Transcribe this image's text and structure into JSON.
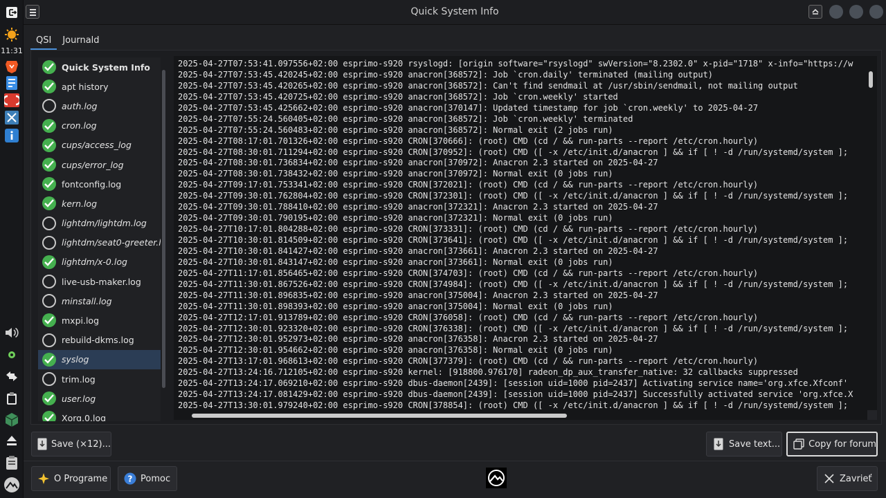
{
  "panel": {
    "clock": "11:31",
    "icons": [
      "exit-icon",
      "weather-icon",
      "brave-browser-icon",
      "text-editor-icon",
      "app-icon",
      "tools-icon",
      "info-icon",
      "volume-icon",
      "settings-icon",
      "network-icon",
      "clipboard-icon",
      "package-icon",
      "eject-icon",
      "clipboard-manager-icon",
      "mx-logo-icon"
    ]
  },
  "window": {
    "title": "Quick System Info",
    "buttons": [
      "menu-icon",
      "maximize-icon",
      "minimize-icon",
      "close-icon"
    ]
  },
  "tabs": [
    {
      "label": "QSI",
      "active": true
    },
    {
      "label": "Journald",
      "active": false
    }
  ],
  "files": [
    {
      "label": "Quick System Info",
      "checked": true,
      "bold": true,
      "italic": false
    },
    {
      "label": "apt history",
      "checked": true,
      "bold": false,
      "italic": false
    },
    {
      "label": "auth.log",
      "checked": false,
      "bold": false,
      "italic": true
    },
    {
      "label": "cron.log",
      "checked": true,
      "bold": false,
      "italic": true
    },
    {
      "label": "cups/access_log",
      "checked": true,
      "bold": false,
      "italic": true
    },
    {
      "label": "cups/error_log",
      "checked": true,
      "bold": false,
      "italic": true
    },
    {
      "label": "fontconfig.log",
      "checked": true,
      "bold": false,
      "italic": false
    },
    {
      "label": "kern.log",
      "checked": true,
      "bold": false,
      "italic": true
    },
    {
      "label": "lightdm/lightdm.log",
      "checked": false,
      "bold": false,
      "italic": true
    },
    {
      "label": "lightdm/seat0-greeter.log",
      "checked": false,
      "bold": false,
      "italic": true
    },
    {
      "label": "lightdm/x-0.log",
      "checked": true,
      "bold": false,
      "italic": true
    },
    {
      "label": "live-usb-maker.log",
      "checked": false,
      "bold": false,
      "italic": false
    },
    {
      "label": "minstall.log",
      "checked": false,
      "bold": false,
      "italic": true
    },
    {
      "label": "mxpi.log",
      "checked": true,
      "bold": false,
      "italic": false
    },
    {
      "label": "rebuild-dkms.log",
      "checked": false,
      "bold": false,
      "italic": false
    },
    {
      "label": "syslog",
      "checked": true,
      "bold": false,
      "italic": true,
      "selected": true
    },
    {
      "label": "trim.log",
      "checked": false,
      "bold": false,
      "italic": false
    },
    {
      "label": "user.log",
      "checked": true,
      "bold": false,
      "italic": true
    },
    {
      "label": "Xorg.0.log",
      "checked": true,
      "bold": false,
      "italic": false
    }
  ],
  "log_lines": [
    "2025-04-27T07:53:41.097556+02:00 esprimo-s920 rsyslogd: [origin software=\"rsyslogd\" swVersion=\"8.2302.0\" x-pid=\"1718\" x-info=\"https://w",
    "2025-04-27T07:53:45.420245+02:00 esprimo-s920 anacron[368572]: Job `cron.daily' terminated (mailing output)",
    "2025-04-27T07:53:45.420265+02:00 esprimo-s920 anacron[368572]: Can't find sendmail at /usr/sbin/sendmail, not mailing output",
    "2025-04-27T07:53:45.420725+02:00 esprimo-s920 anacron[368572]: Job `cron.weekly' started",
    "2025-04-27T07:53:45.425662+02:00 esprimo-s920 anacron[370147]: Updated timestamp for job `cron.weekly' to 2025-04-27",
    "2025-04-27T07:55:24.560405+02:00 esprimo-s920 anacron[368572]: Job `cron.weekly' terminated",
    "2025-04-27T07:55:24.560483+02:00 esprimo-s920 anacron[368572]: Normal exit (2 jobs run)",
    "2025-04-27T08:17:01.701326+02:00 esprimo-s920 CRON[370666]: (root) CMD (cd / && run-parts --report /etc/cron.hourly)",
    "2025-04-27T08:30:01.711294+02:00 esprimo-s920 CRON[370952]: (root) CMD ([ -x /etc/init.d/anacron ] && if [ ! -d /run/systemd/system ];",
    "2025-04-27T08:30:01.736834+02:00 esprimo-s920 anacron[370972]: Anacron 2.3 started on 2025-04-27",
    "2025-04-27T08:30:01.738432+02:00 esprimo-s920 anacron[370972]: Normal exit (0 jobs run)",
    "2025-04-27T09:17:01.753341+02:00 esprimo-s920 CRON[372021]: (root) CMD (cd / && run-parts --report /etc/cron.hourly)",
    "2025-04-27T09:30:01.762804+02:00 esprimo-s920 CRON[372301]: (root) CMD ([ -x /etc/init.d/anacron ] && if [ ! -d /run/systemd/system ];",
    "2025-04-27T09:30:01.788410+02:00 esprimo-s920 anacron[372321]: Anacron 2.3 started on 2025-04-27",
    "2025-04-27T09:30:01.790195+02:00 esprimo-s920 anacron[372321]: Normal exit (0 jobs run)",
    "2025-04-27T10:17:01.804288+02:00 esprimo-s920 CRON[373331]: (root) CMD (cd / && run-parts --report /etc/cron.hourly)",
    "2025-04-27T10:30:01.814509+02:00 esprimo-s920 CRON[373641]: (root) CMD ([ -x /etc/init.d/anacron ] && if [ ! -d /run/systemd/system ];",
    "2025-04-27T10:30:01.841427+02:00 esprimo-s920 anacron[373661]: Anacron 2.3 started on 2025-04-27",
    "2025-04-27T10:30:01.843147+02:00 esprimo-s920 anacron[373661]: Normal exit (0 jobs run)",
    "2025-04-27T11:17:01.856465+02:00 esprimo-s920 CRON[374703]: (root) CMD (cd / && run-parts --report /etc/cron.hourly)",
    "2025-04-27T11:30:01.867526+02:00 esprimo-s920 CRON[374984]: (root) CMD ([ -x /etc/init.d/anacron ] && if [ ! -d /run/systemd/system ];",
    "2025-04-27T11:30:01.896835+02:00 esprimo-s920 anacron[375004]: Anacron 2.3 started on 2025-04-27",
    "2025-04-27T11:30:01.898393+02:00 esprimo-s920 anacron[375004]: Normal exit (0 jobs run)",
    "2025-04-27T12:17:01.913789+02:00 esprimo-s920 CRON[376058]: (root) CMD (cd / && run-parts --report /etc/cron.hourly)",
    "2025-04-27T12:30:01.923320+02:00 esprimo-s920 CRON[376338]: (root) CMD ([ -x /etc/init.d/anacron ] && if [ ! -d /run/systemd/system ];",
    "2025-04-27T12:30:01.952973+02:00 esprimo-s920 anacron[376358]: Anacron 2.3 started on 2025-04-27",
    "2025-04-27T12:30:01.954662+02:00 esprimo-s920 anacron[376358]: Normal exit (0 jobs run)",
    "2025-04-27T13:17:01.968613+02:00 esprimo-s920 CRON[377379]: (root) CMD (cd / && run-parts --report /etc/cron.hourly)",
    "2025-04-27T13:24:16.712105+02:00 esprimo-s920 kernel: [918800.976170] radeon_dp_aux_transfer_native: 32 callbacks suppressed",
    "2025-04-27T13:24:17.069210+02:00 esprimo-s920 dbus-daemon[2439]: [session uid=1000 pid=2437] Activating service name='org.xfce.Xfconf'",
    "2025-04-27T13:24:17.081429+02:00 esprimo-s920 dbus-daemon[2439]: [session uid=1000 pid=2437] Successfully activated service 'org.xfce.X",
    "2025-04-27T13:30:01.979240+02:00 esprimo-s920 CRON[378854]: (root) CMD ([ -x /etc/init.d/anacron ] && if [ ! -d /run/systemd/system ];"
  ],
  "buttons": {
    "save_all": "Save (×12)...",
    "save_text": "Save text...",
    "copy_forum": "Copy for forum",
    "about": "O Programe",
    "help": "Pomoc",
    "close": "Zavrieť"
  },
  "colors": {
    "check_green": "#45b04f",
    "selection": "#2b3d55",
    "tab_accent": "#4a8fd8"
  }
}
